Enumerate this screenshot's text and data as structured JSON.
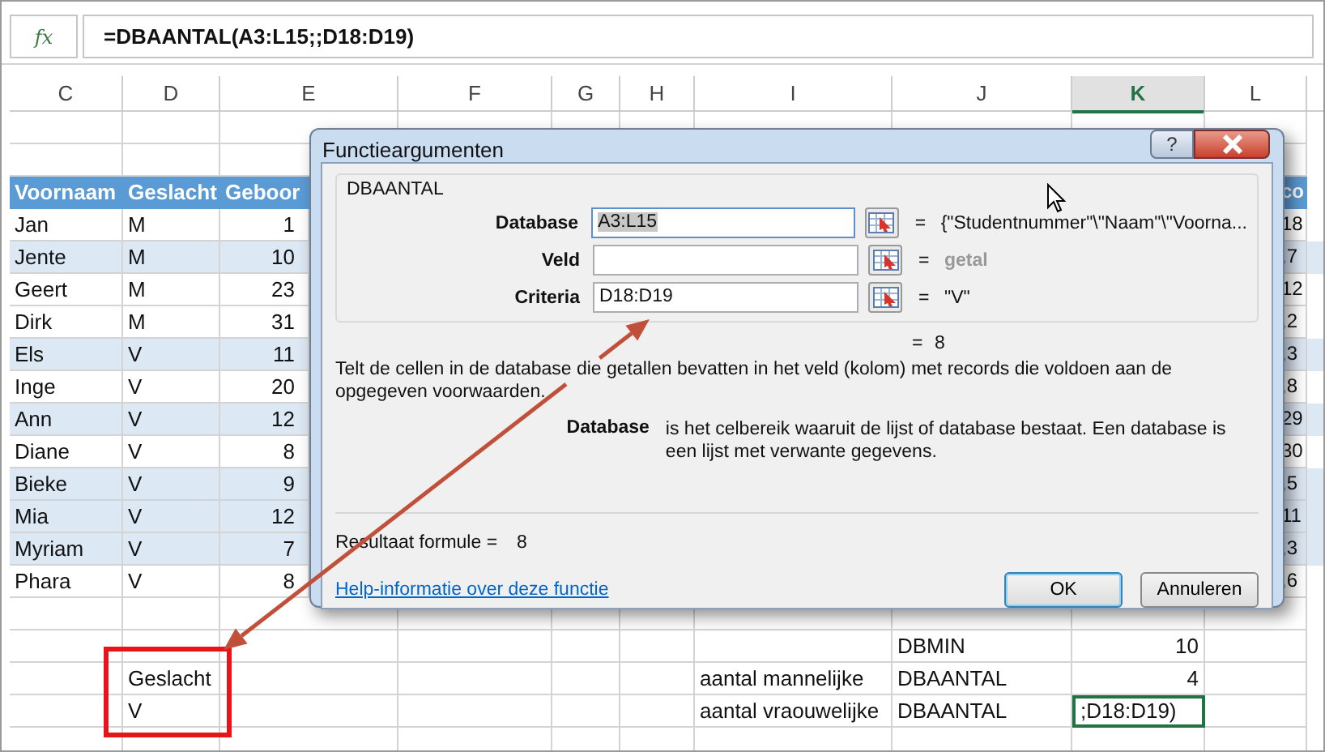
{
  "formula_bar": {
    "function_label": "fx",
    "formula": "=DBAANTAL(A3:L15;;D18:D19)"
  },
  "columns": [
    {
      "label": "C",
      "selected": false
    },
    {
      "label": "D",
      "selected": false
    },
    {
      "label": "E",
      "selected": false
    },
    {
      "label": "F",
      "selected": false
    },
    {
      "label": "G",
      "selected": false
    },
    {
      "label": "H",
      "selected": false
    },
    {
      "label": "I",
      "selected": false
    },
    {
      "label": "J",
      "selected": false
    },
    {
      "label": "K",
      "selected": true
    },
    {
      "label": "L",
      "selected": false
    }
  ],
  "table": {
    "header": {
      "voornaam": "Voornaam",
      "geslacht": "Geslacht",
      "column_e": "Geboor",
      "column_l": "co"
    },
    "rows": [
      {
        "voornaam": "Jan",
        "geslacht": "M",
        "column_e": "1",
        "column_l": "18",
        "highlighted": false
      },
      {
        "voornaam": "Jente",
        "geslacht": "M",
        "column_e": "10",
        "column_l": ",7",
        "highlighted": true
      },
      {
        "voornaam": "Geert",
        "geslacht": "M",
        "column_e": "23",
        "column_l": "12",
        "highlighted": false
      },
      {
        "voornaam": "Dirk",
        "geslacht": "M",
        "column_e": "31",
        "column_l": ",2",
        "highlighted": false
      },
      {
        "voornaam": "Els",
        "geslacht": "V",
        "column_e": "11",
        "column_l": ",3",
        "highlighted": true
      },
      {
        "voornaam": "Inge",
        "geslacht": "V",
        "column_e": "20",
        "column_l": ",8",
        "highlighted": false
      },
      {
        "voornaam": "Ann",
        "geslacht": "V",
        "column_e": "12",
        "column_l": "29",
        "highlighted": true
      },
      {
        "voornaam": "Diane",
        "geslacht": "V",
        "column_e": "8",
        "column_l": "30",
        "highlighted": false
      },
      {
        "voornaam": "Bieke",
        "geslacht": "V",
        "column_e": "9",
        "column_l": ",5",
        "highlighted": true
      },
      {
        "voornaam": "Mia",
        "geslacht": "V",
        "column_e": "12",
        "column_l": "11",
        "highlighted": true
      },
      {
        "voornaam": "Myriam",
        "geslacht": "V",
        "column_e": "7",
        "column_l": ",3",
        "highlighted": true
      },
      {
        "voornaam": "Phara",
        "geslacht": "V",
        "column_e": "8",
        "column_l": ",6",
        "highlighted": false
      }
    ]
  },
  "summary_rows": [
    {
      "column_j": "DBMIN",
      "column_k": "10",
      "active": false
    },
    {
      "column_d": "Geslacht",
      "column_i": "aantal mannelijke",
      "column_j": "DBAANTAL",
      "column_k": "4",
      "active": false
    },
    {
      "column_d": "V",
      "column_i": "aantal vraouwelijke",
      "column_j": "DBAANTAL",
      "column_k": ";D18:D19)",
      "active": true
    }
  ],
  "dialog": {
    "title": "Functieargumenten",
    "help_button": "?",
    "group_title": "DBAANTAL",
    "arguments": [
      {
        "label": "Database",
        "value": "A3:L15",
        "selected": true,
        "sign": "=",
        "result": "{\"Studentnummer\"\\\"Naam\"\\\"Voorna...",
        "dimmed": false
      },
      {
        "label": "Veld",
        "selected": false,
        "sign": "=",
        "result": "getal",
        "dimmed": true
      },
      {
        "label": "Criteria",
        "value": "D18:D19",
        "selected": false,
        "sign": "=",
        "result": "\"V\"",
        "dimmed": false
      }
    ],
    "total_sign": "=",
    "total": "8",
    "description": "Telt de cellen in de database die getallen bevatten in het veld (kolom) met records die voldoen aan de opgegeven voorwaarden.",
    "argument_name": "Database",
    "argument_help": "is het celbereik waaruit de lijst of database bestaat. Een database is een lijst met verwante gegevens.",
    "result_label": "Resultaat formule =",
    "result_value": "8",
    "help_link": "Help-informatie over deze functie",
    "buttons": [
      {
        "label": "OK",
        "default": true
      },
      {
        "label": "Annuleren",
        "default": false
      }
    ]
  }
}
